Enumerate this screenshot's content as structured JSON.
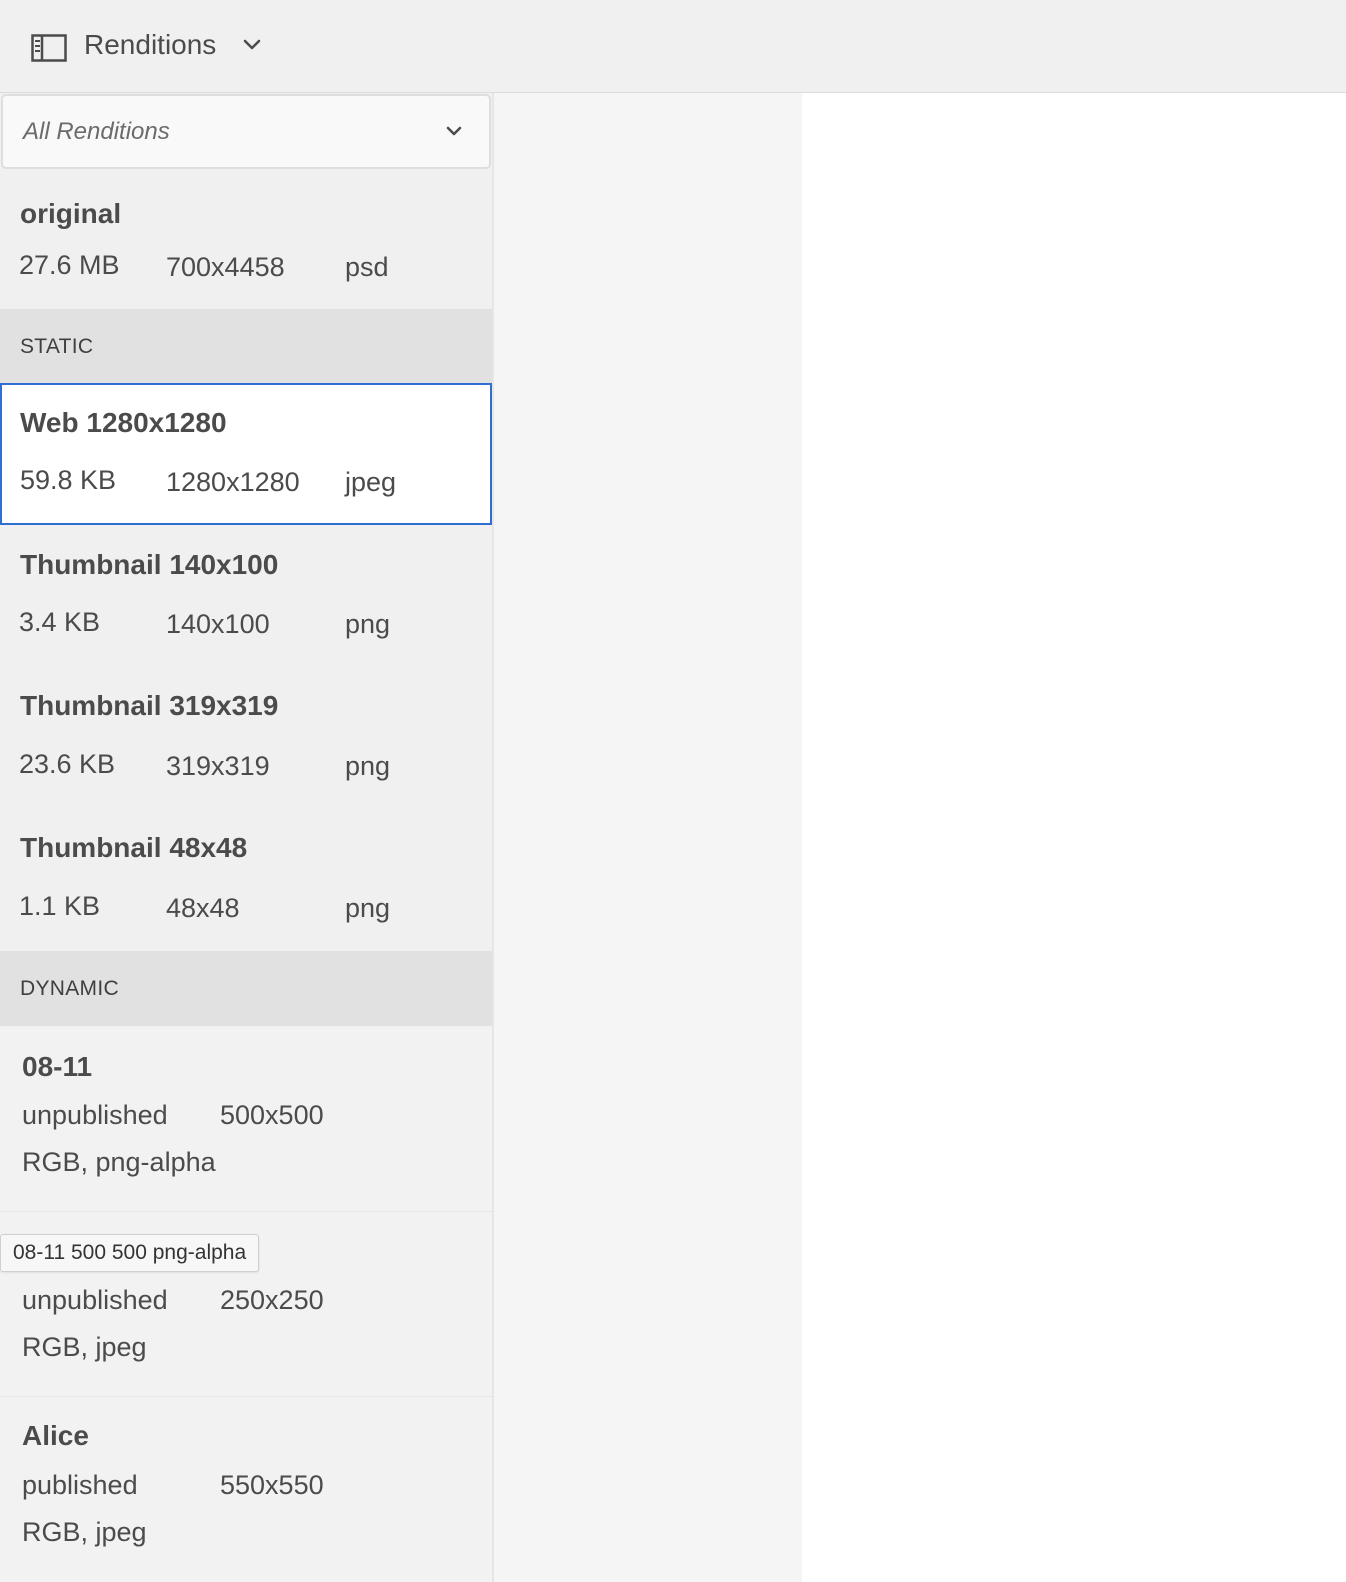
{
  "header": {
    "title": "Renditions",
    "rail_icon": "panel-rail-icon",
    "chevron_icon": "chevron-down-icon"
  },
  "filter": {
    "selected": "All Renditions",
    "chevron_icon": "chevron-down-icon"
  },
  "original": {
    "name": "original",
    "size": "27.6 MB",
    "dimensions": "700x4458",
    "format": "psd"
  },
  "sections": {
    "static": "STATIC",
    "dynamic": "DYNAMIC"
  },
  "static_items": [
    {
      "name": "Web 1280x1280",
      "size": "59.8 KB",
      "dimensions": "1280x1280",
      "format": "jpeg",
      "selected": true
    },
    {
      "name": "Thumbnail 140x100",
      "size": "3.4 KB",
      "dimensions": "140x100",
      "format": "png"
    },
    {
      "name": "Thumbnail 319x319",
      "size": "23.6 KB",
      "dimensions": "319x319",
      "format": "png"
    },
    {
      "name": "Thumbnail 48x48",
      "size": "1.1 KB",
      "dimensions": "48x48",
      "format": "png"
    }
  ],
  "dynamic_items": [
    {
      "name": "08-11",
      "status": "unpublished",
      "dimensions": "500x500",
      "format": "RGB, png-alpha"
    },
    {
      "name": "",
      "status": "unpublished",
      "dimensions": "250x250",
      "format": "RGB, jpeg"
    },
    {
      "name": "Alice",
      "status": "published",
      "dimensions": "550x550",
      "format": "RGB, jpeg"
    }
  ],
  "tooltip": "08-11 500 500 png-alpha",
  "colors": {
    "selection_border": "#2f6fd1",
    "panel_bg": "#f0f0f0",
    "section_bg": "#e1e1e1"
  }
}
